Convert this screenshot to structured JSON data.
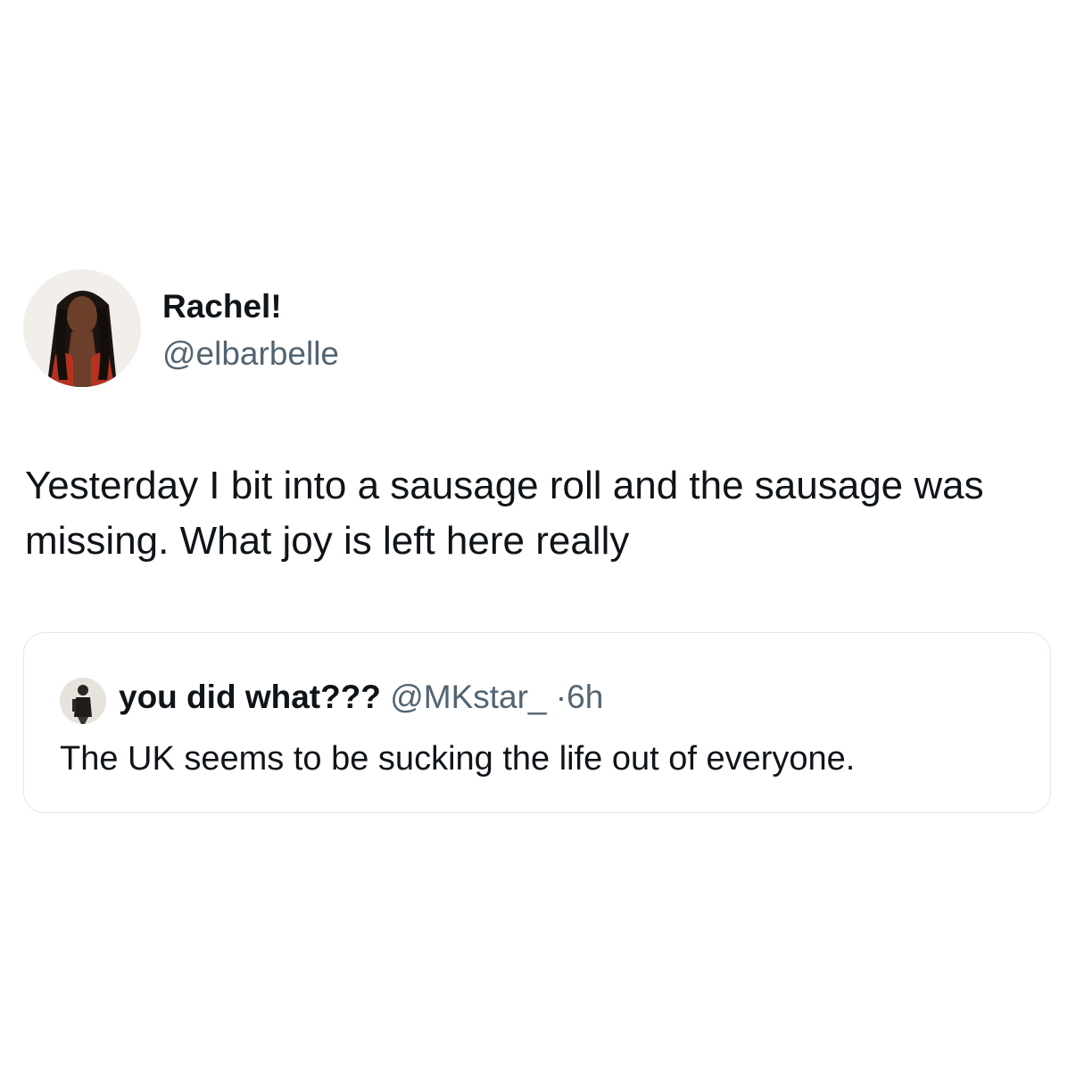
{
  "tweet": {
    "author": {
      "display_name": "Rachel!",
      "handle": "@elbarbelle",
      "avatar_icon": "profile-photo"
    },
    "text": "Yesterday I bit into a sausage roll and the sausage was missing. What joy is left here really",
    "quoted_tweet": {
      "display_name": "you did what???",
      "handle": "@MKstar_",
      "separator": "·",
      "time": "6h",
      "avatar_icon": "profile-photo",
      "text": "The UK seems to be sucking the life out of everyone."
    }
  },
  "colors": {
    "text_primary": "#0f1419",
    "text_secondary": "#536471",
    "card_border": "#e3e7ea",
    "background": "#ffffff"
  }
}
